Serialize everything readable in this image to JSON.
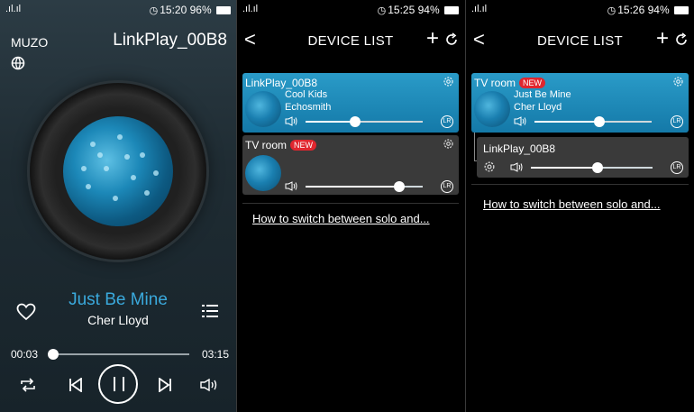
{
  "status_bars": [
    {
      "signal": ".ıl.ıl",
      "time": "15:20",
      "battery": "96%"
    },
    {
      "signal": ".ıl.ıl",
      "time": "15:25",
      "battery": "94%"
    },
    {
      "signal": ".ıl.ıl",
      "time": "15:26",
      "battery": "94%"
    }
  ],
  "player": {
    "app_name": "MUZO",
    "device_name": "LinkPlay_00B8",
    "song_title": "Just Be Mine",
    "artist": "Cher Lloyd",
    "current_time": "00:03",
    "duration": "03:15",
    "progress": 0.02
  },
  "device_list_1": {
    "title": "DEVICE LIST",
    "back": "<",
    "add": "+",
    "devices": [
      {
        "name": "LinkPlay_00B8",
        "track": "Cool Kids",
        "artist": "Echosmith",
        "volume": 0.42,
        "channel": "LR"
      },
      {
        "name": "TV room",
        "badge": "NEW",
        "volume": 0.8,
        "channel": "LR"
      }
    ],
    "help_link": "How to switch between solo and..."
  },
  "device_list_2": {
    "title": "DEVICE LIST",
    "back": "<",
    "add": "+",
    "master": {
      "name": "TV room",
      "badge": "NEW",
      "track": "Just Be Mine",
      "artist": "Cher Lloyd",
      "volume": 0.55,
      "channel": "LR"
    },
    "slave": {
      "name": "LinkPlay_00B8",
      "volume": 0.55,
      "channel": "LR"
    },
    "help_link": "How to switch between solo and..."
  },
  "colors": {
    "accent": "#2a9bc8",
    "title_blue": "#3aa9dc",
    "new_badge": "#e0262e"
  }
}
